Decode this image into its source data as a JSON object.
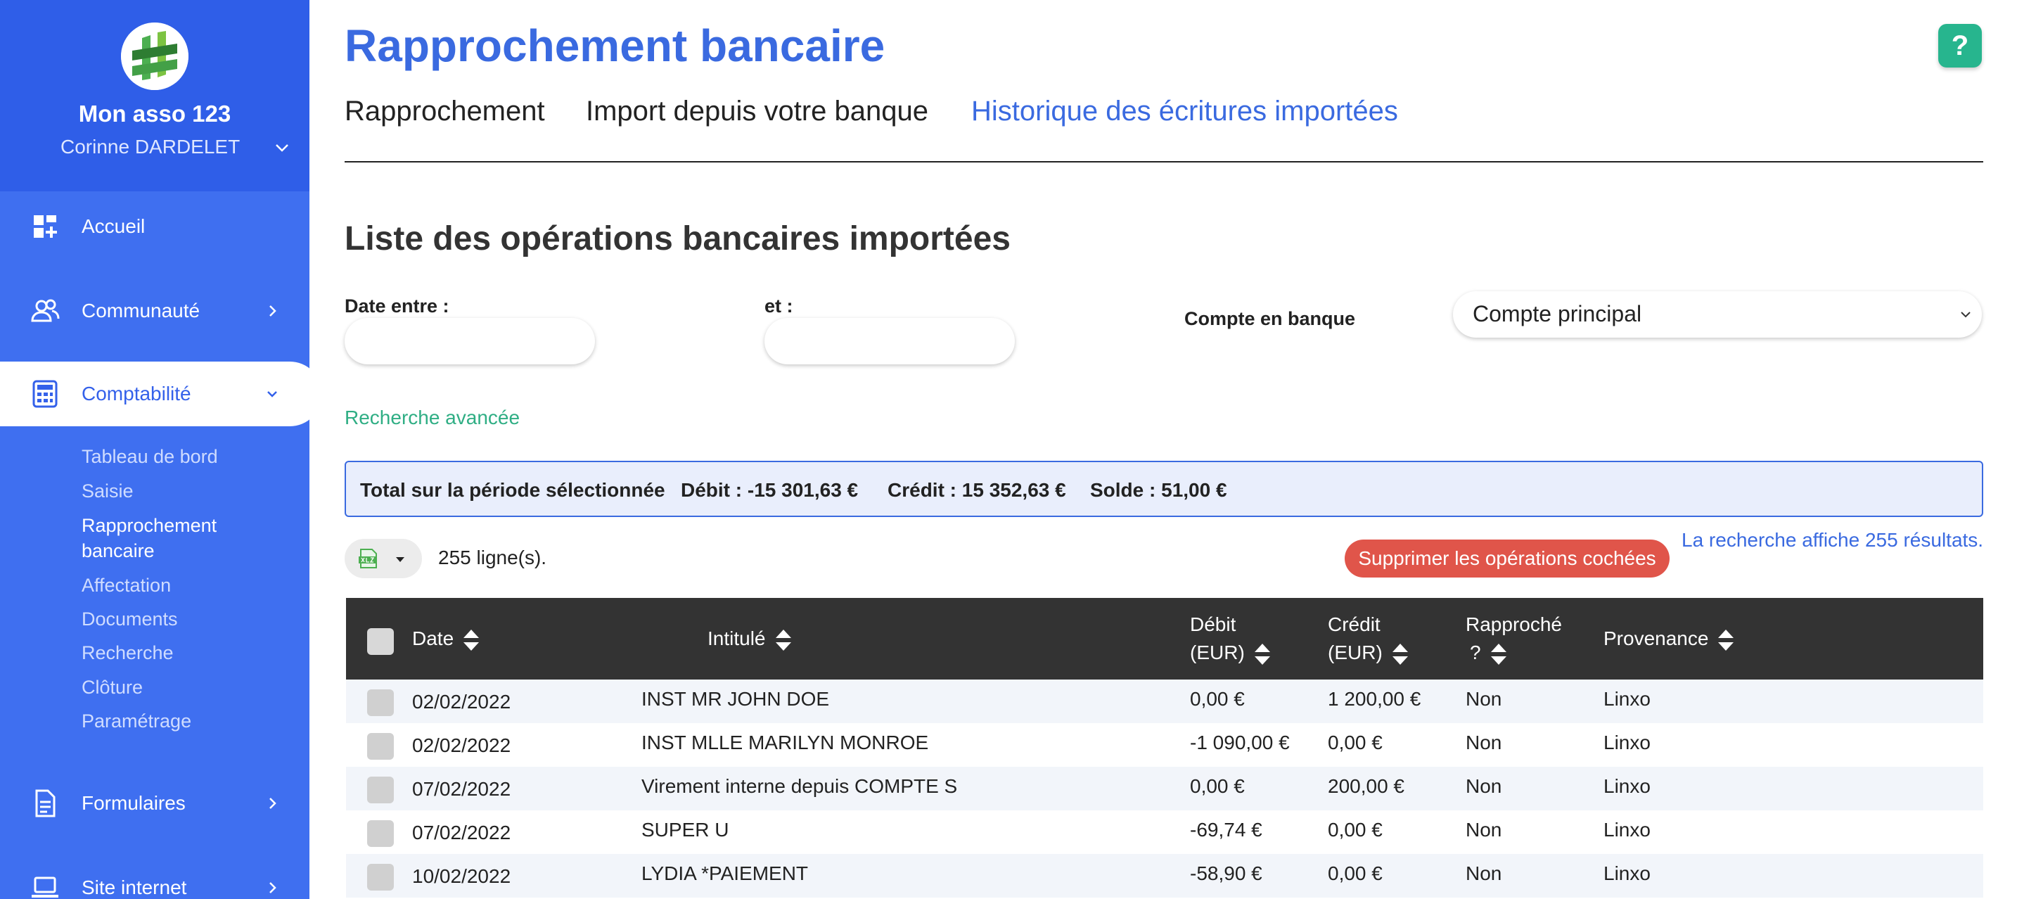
{
  "sidebar": {
    "org_name": "Mon asso 123",
    "user_name": "Corinne DARDELET",
    "nav": [
      {
        "label": "Accueil",
        "icon": "dashboard-icon"
      },
      {
        "label": "Communauté",
        "icon": "users-icon"
      },
      {
        "label": "Comptabilité",
        "icon": "calculator-icon"
      },
      {
        "label": "Formulaires",
        "icon": "document-icon"
      },
      {
        "label": "Site internet",
        "icon": "laptop-icon"
      }
    ],
    "sub_items": [
      "Tableau de bord",
      "Saisie",
      "Rapprochement",
      "bancaire",
      "Affectation",
      "Documents",
      "Recherche",
      "Clôture",
      "Paramétrage"
    ]
  },
  "header": {
    "title": "Rapprochement bancaire",
    "help": "?",
    "tabs": [
      "Rapprochement",
      "Import depuis votre banque",
      "Historique des écritures importées"
    ]
  },
  "section_title": "Liste des opérations bancaires importées",
  "filters": {
    "date_from_label": "Date entre :",
    "date_to_label": "et :",
    "account_label": "Compte en banque",
    "account_value": "Compte principal",
    "advanced_search": "Recherche avancée"
  },
  "totals": {
    "label": "Total sur la période sélectionnée",
    "debit": "Débit : -15 301,63 €",
    "credit": "Crédit : 15 352,63 €",
    "balance": "Solde : 51,00 €"
  },
  "toolbar": {
    "row_count": "255 ligne(s).",
    "delete_label": "Supprimer les opérations cochées",
    "results_text": "La recherche affiche 255 résultats."
  },
  "table": {
    "headers": {
      "date": "Date",
      "intitule": "Intitulé",
      "debit_1": "Débit",
      "debit_2": "(EUR)",
      "credit_1": "Crédit",
      "credit_2": "(EUR)",
      "rapproche_1": "Rapproché",
      "rapproche_2": "?",
      "provenance": "Provenance"
    },
    "rows": [
      {
        "date": "02/02/2022",
        "intitule": "INST MR JOHN DOE",
        "debit": "0,00 €",
        "credit": "1 200,00 €",
        "rapproche": "Non",
        "provenance": "Linxo"
      },
      {
        "date": "02/02/2022",
        "intitule": "INST MLLE MARILYN MONROE",
        "debit": "-1 090,00 €",
        "credit": "0,00 €",
        "rapproche": "Non",
        "provenance": "Linxo"
      },
      {
        "date": "07/02/2022",
        "intitule": "Virement interne depuis COMPTE S",
        "debit": "0,00 €",
        "credit": "200,00 €",
        "rapproche": "Non",
        "provenance": "Linxo"
      },
      {
        "date": "07/02/2022",
        "intitule": "SUPER U",
        "debit": "-69,74 €",
        "credit": "0,00 €",
        "rapproche": "Non",
        "provenance": "Linxo"
      },
      {
        "date": "10/02/2022",
        "intitule": "LYDIA *PAIEMENT",
        "debit": "-58,90 €",
        "credit": "0,00 €",
        "rapproche": "Non",
        "provenance": "Linxo"
      }
    ]
  },
  "colors": {
    "sidebar": "#3f6ff0",
    "accent_blue": "#3a6ae0",
    "green": "#27b58e",
    "danger": "#e0554a",
    "table_header": "#333333"
  }
}
